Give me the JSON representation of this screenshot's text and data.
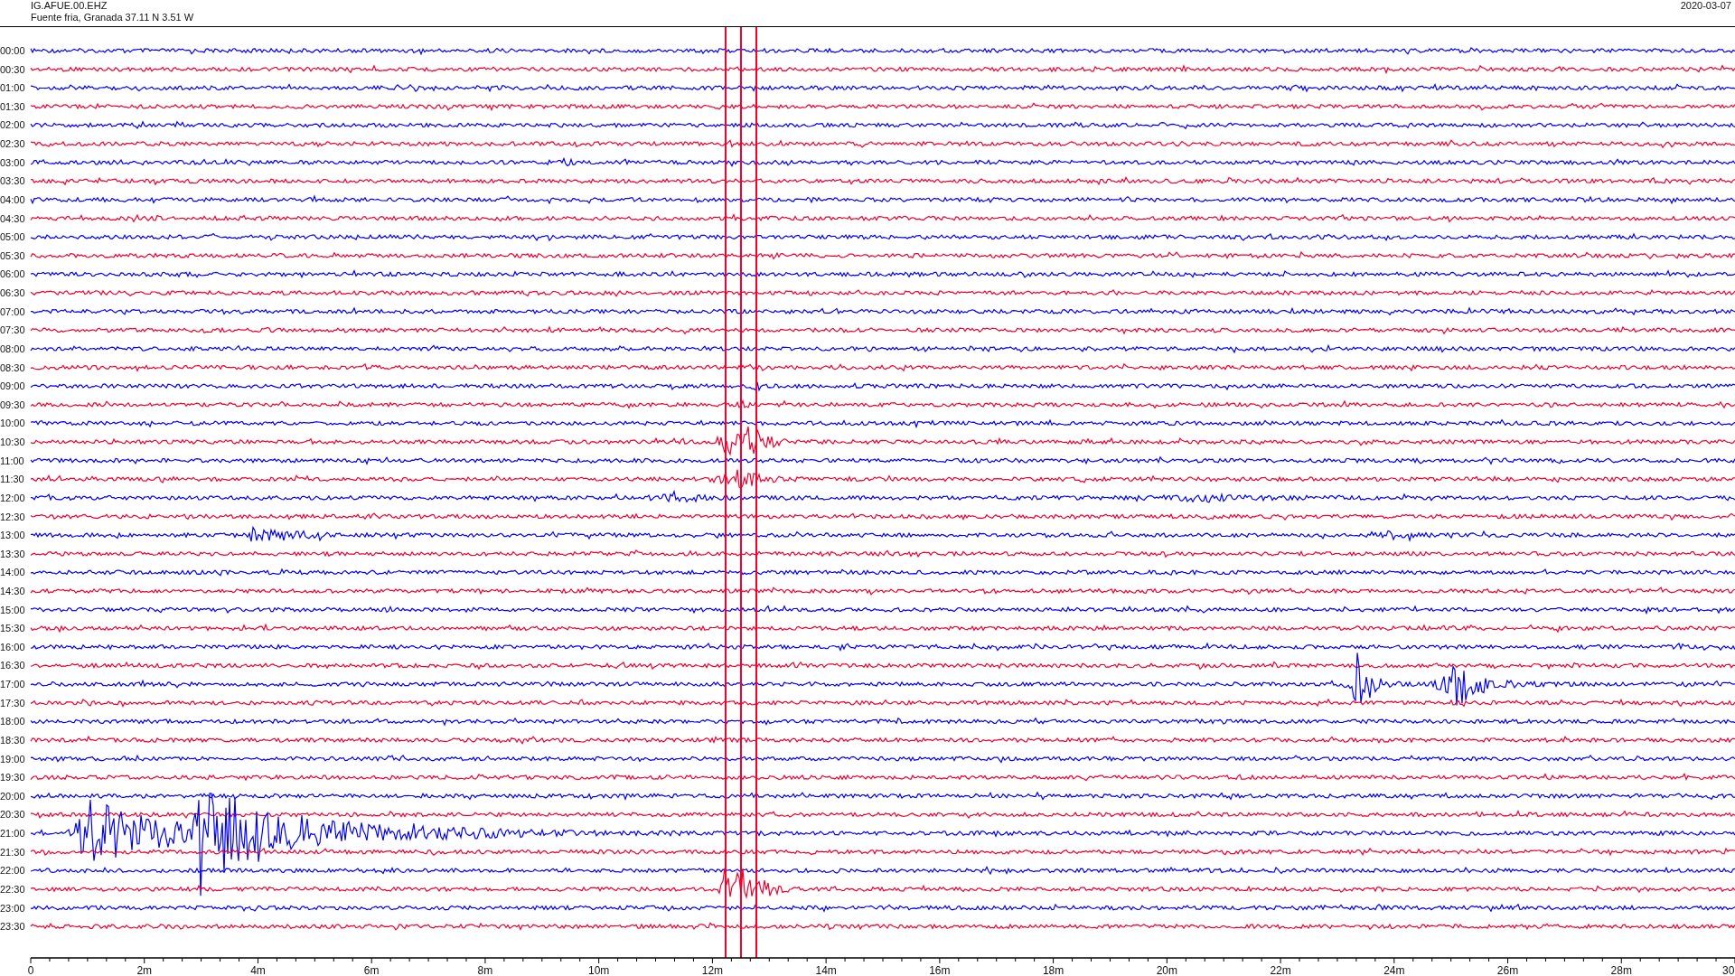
{
  "header": {
    "station_code": "IG.AFUE.00.EHZ",
    "location": "Fuente fria, Granada  37.11 N 3.51 W",
    "date": "2020-03-07"
  },
  "traces": [
    {
      "time": "00:00",
      "color": "#0000ff"
    },
    {
      "time": "00:30",
      "color": "#f2002e"
    },
    {
      "time": "01:00",
      "color": "#0000ff"
    },
    {
      "time": "01:30",
      "color": "#f2002e"
    },
    {
      "time": "02:00",
      "color": "#0000ff"
    },
    {
      "time": "02:30",
      "color": "#f2002e"
    },
    {
      "time": "03:00",
      "color": "#0000ff"
    },
    {
      "time": "03:30",
      "color": "#f2002e"
    },
    {
      "time": "04:00",
      "color": "#0000ff"
    },
    {
      "time": "04:30",
      "color": "#f2002e"
    },
    {
      "time": "05:00",
      "color": "#0000ff"
    },
    {
      "time": "05:30",
      "color": "#f2002e"
    },
    {
      "time": "06:00",
      "color": "#0000ff"
    },
    {
      "time": "06:30",
      "color": "#f2002e"
    },
    {
      "time": "07:00",
      "color": "#0000ff"
    },
    {
      "time": "07:30",
      "color": "#f2002e"
    },
    {
      "time": "08:00",
      "color": "#0000ff"
    },
    {
      "time": "08:30",
      "color": "#f2002e"
    },
    {
      "time": "09:00",
      "color": "#0000ff"
    },
    {
      "time": "09:30",
      "color": "#f2002e"
    },
    {
      "time": "10:00",
      "color": "#0000ff"
    },
    {
      "time": "10:30",
      "color": "#f2002e"
    },
    {
      "time": "11:00",
      "color": "#0000ff"
    },
    {
      "time": "11:30",
      "color": "#f2002e"
    },
    {
      "time": "12:00",
      "color": "#0000ff"
    },
    {
      "time": "12:30",
      "color": "#f2002e"
    },
    {
      "time": "13:00",
      "color": "#0000ff"
    },
    {
      "time": "13:30",
      "color": "#f2002e"
    },
    {
      "time": "14:00",
      "color": "#0000ff"
    },
    {
      "time": "14:30",
      "color": "#f2002e"
    },
    {
      "time": "15:00",
      "color": "#0000ff"
    },
    {
      "time": "15:30",
      "color": "#f2002e"
    },
    {
      "time": "16:00",
      "color": "#0000ff"
    },
    {
      "time": "16:30",
      "color": "#f2002e"
    },
    {
      "time": "17:00",
      "color": "#0000ff"
    },
    {
      "time": "17:30",
      "color": "#f2002e"
    },
    {
      "time": "18:00",
      "color": "#0000ff"
    },
    {
      "time": "18:30",
      "color": "#f2002e"
    },
    {
      "time": "19:00",
      "color": "#0000ff"
    },
    {
      "time": "19:30",
      "color": "#f2002e"
    },
    {
      "time": "20:00",
      "color": "#0000ff"
    },
    {
      "time": "20:30",
      "color": "#f2002e"
    },
    {
      "time": "21:00",
      "color": "#0000ff"
    },
    {
      "time": "21:30",
      "color": "#f2002e"
    },
    {
      "time": "22:00",
      "color": "#0000ff"
    },
    {
      "time": "22:30",
      "color": "#f2002e"
    },
    {
      "time": "23:00",
      "color": "#0000ff"
    },
    {
      "time": "23:30",
      "color": "#f2002e"
    }
  ],
  "x_axis": {
    "labels": [
      "0",
      "2m",
      "4m",
      "6m",
      "8m",
      "10m",
      "12m",
      "14m",
      "16m",
      "18m",
      "20m",
      "22m",
      "24m",
      "26m",
      "28m",
      "30"
    ]
  }
}
